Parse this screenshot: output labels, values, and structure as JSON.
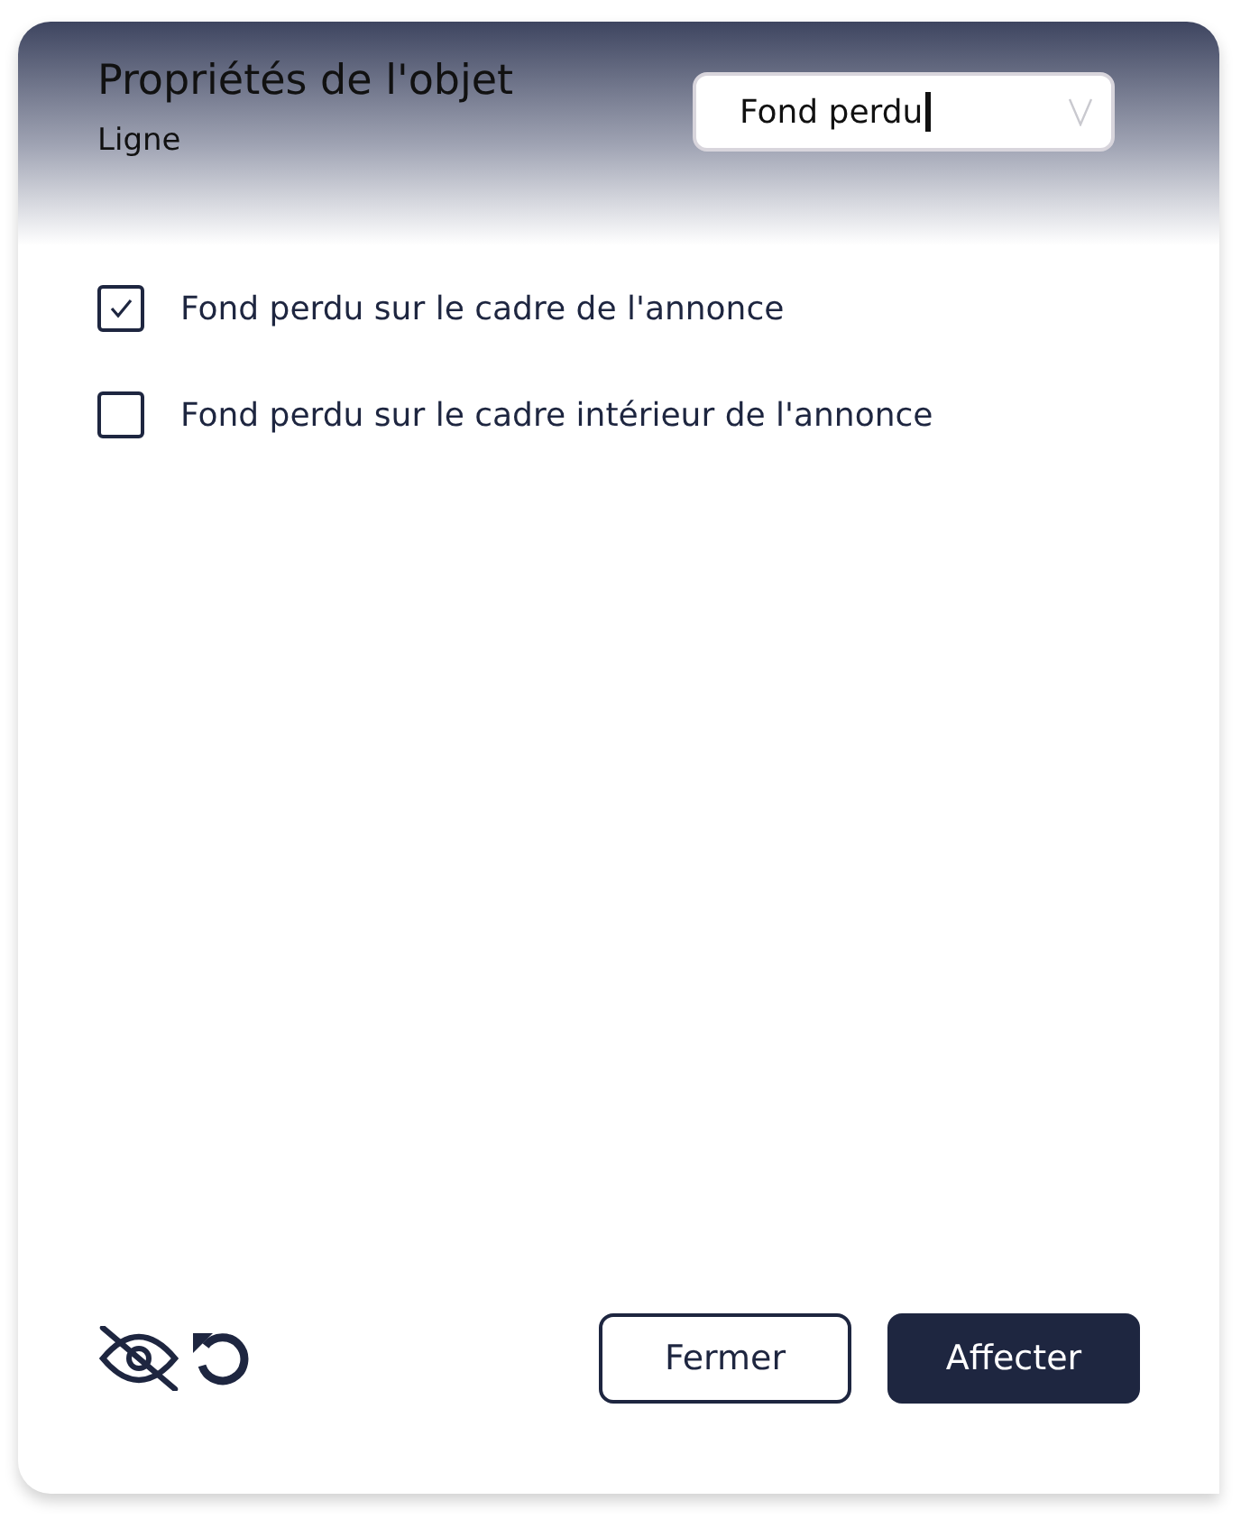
{
  "header": {
    "title": "Propriétés de l'objet",
    "subtitle": "Ligne"
  },
  "dropdown": {
    "value": "Fond perdu"
  },
  "options": [
    {
      "label": "Fond perdu sur le cadre de l'annonce",
      "checked": true
    },
    {
      "label": "Fond perdu sur le cadre intérieur de l'annonce",
      "checked": false
    }
  ],
  "buttons": [
    {
      "label": "Fermer",
      "kind": "secondary"
    },
    {
      "label": "Affecter",
      "kind": "primary"
    }
  ]
}
